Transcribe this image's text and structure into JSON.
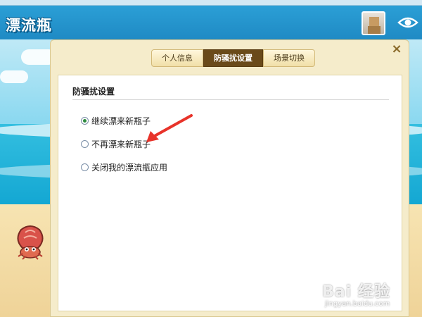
{
  "app": {
    "logo_text": "漂流瓶"
  },
  "dialog": {
    "close_label": "×",
    "tabs": [
      {
        "label": "个人信息",
        "active": false
      },
      {
        "label": "防骚扰设置",
        "active": true
      },
      {
        "label": "场景切换",
        "active": false
      }
    ],
    "section_title": "防骚扰设置",
    "options": [
      {
        "label": "继续漂来新瓶子",
        "checked": true
      },
      {
        "label": "不再漂来新瓶子",
        "checked": false
      },
      {
        "label": "关闭我的漂流瓶应用",
        "checked": false
      }
    ]
  },
  "watermark": {
    "main": "Bai 经验",
    "sub": "jingyan.baidu.com"
  },
  "colors": {
    "header": "#2b9fd6",
    "dialog_bg": "#f5eccb",
    "active_tab": "#6a4a1a",
    "arrow": "#e8332a"
  }
}
